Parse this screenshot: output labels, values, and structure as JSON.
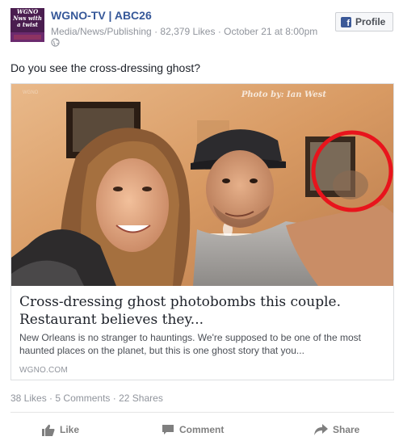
{
  "post": {
    "page_name": "WGNO-TV | ABC26",
    "category": "Media/News/Publishing",
    "likes": "82,379 Likes",
    "timestamp": "October 21 at 8:00pm",
    "separator": "·",
    "avatar_text": "WGNO Nws with a twist",
    "profile_button": "Profile",
    "text": "Do you see the cross-dressing ghost?",
    "icons": {
      "privacy": "globe-icon",
      "profile": "facebook-icon",
      "like": "thumbs-up-icon",
      "comment": "speech-bubble-icon",
      "share": "share-arrow-icon"
    }
  },
  "link": {
    "photo_credit": "Photo by: Ian West",
    "watermark": "WGNO",
    "title": "Cross-dressing ghost photobombs this couple. Restaurant believes they...",
    "description": "New Orleans is no stranger to hauntings. We're supposed to be one of the most haunted places on the planet, but this is one ghost story that you...",
    "domain": "WGNO.COM",
    "highlight_color": "#e8141c"
  },
  "stats": {
    "likes": "38 Likes",
    "comments": "5 Comments",
    "shares": "22 Shares",
    "separator": "·"
  },
  "actions": {
    "like": "Like",
    "comment": "Comment",
    "share": "Share"
  },
  "colors": {
    "link_blue": "#365899",
    "meta_gray": "#90949c",
    "fb_blue": "#3b5998"
  }
}
